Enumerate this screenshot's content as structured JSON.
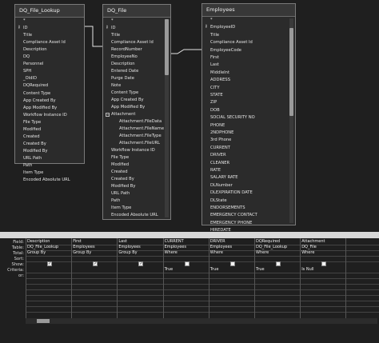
{
  "tables": [
    {
      "title": "DQ_File_Lookup",
      "fields": [
        "*",
        "ID",
        "Title",
        "Compliance Asset Id",
        "Description",
        "DQ",
        "Personnel",
        "SPH",
        "_OldID",
        "DQRequired",
        "Content Type",
        "App Created By",
        "App Modified By",
        "Workflow Instance ID",
        "File Type",
        "Modified",
        "Created",
        "Created By",
        "Modified By",
        "URL Path",
        "Path",
        "Item Type",
        "Encoded Absolute URL"
      ]
    },
    {
      "title": "DQ_File",
      "fields": [
        "*",
        "ID",
        "Title",
        "Compliance Asset Id",
        "RecordNumber",
        "EmployeeNo",
        "Description",
        "Entered Date",
        "Purge Date",
        "Note",
        "Content Type",
        "App Created By",
        "App Modified By",
        "Attachment",
        "Attachment.FileData",
        "Attachment.FileName",
        "Attachment.FileType",
        "Attachment.FileURL",
        "Workflow Instance ID",
        "File Type",
        "Modified",
        "Created",
        "Created By",
        "Modified By",
        "URL Path",
        "Path",
        "Item Type",
        "Encoded Absolute URL"
      ]
    },
    {
      "title": "Employees",
      "fields": [
        "*",
        "EmployeeID",
        "Title",
        "Compliance Asset Id",
        "EmployeeCode",
        "First",
        "Last",
        "MiddleInt",
        "ADDRESS",
        "CITY",
        "STATE",
        "ZIP",
        "DOB",
        "SOCIAL SECURITY NO",
        "PHONE",
        "2NDPHONE",
        "3rd Phone",
        "CURRENT",
        "DRIVER",
        "CLEANER",
        "RATE",
        "SALARY RATE",
        "DLNumber",
        "DLEXPIRATION DATE",
        "DLState",
        "ENDORSEMENTS",
        "EMERGENCY CONTACT",
        "EMERGENCY PHONE",
        "HIREDATE"
      ]
    }
  ],
  "grid": {
    "row_labels": [
      "Field:",
      "Table:",
      "Total:",
      "Sort:",
      "Show:",
      "Criteria:",
      "or:"
    ],
    "columns": [
      {
        "field": "Description",
        "table": "DQ_File_Lookup",
        "total": "Group By",
        "sort": "",
        "show": true,
        "criteria": ""
      },
      {
        "field": "First",
        "table": "Employees",
        "total": "Group By",
        "sort": "",
        "show": true,
        "criteria": ""
      },
      {
        "field": "Last",
        "table": "Employees",
        "total": "Group By",
        "sort": "",
        "show": true,
        "criteria": ""
      },
      {
        "field": "CURRENT",
        "table": "Employees",
        "total": "Where",
        "sort": "",
        "show": false,
        "criteria": "True"
      },
      {
        "field": "DRIVER",
        "table": "Employees",
        "total": "Where",
        "sort": "",
        "show": false,
        "criteria": "True"
      },
      {
        "field": "DQRequired",
        "table": "DQ_File_Lookup",
        "total": "Where",
        "sort": "",
        "show": false,
        "criteria": "True"
      },
      {
        "field": "Attachment",
        "table": "DQ_File",
        "total": "Where",
        "sort": "",
        "show": false,
        "criteria": "Is Null"
      },
      {
        "field": "",
        "table": "",
        "total": "",
        "sort": "",
        "show": false,
        "criteria": ""
      }
    ]
  },
  "colors": {
    "background": "#1f1f1f",
    "table_bg": "#2b2b2b",
    "border": "#7a7a7a",
    "splitter": "#d8d8d8"
  }
}
